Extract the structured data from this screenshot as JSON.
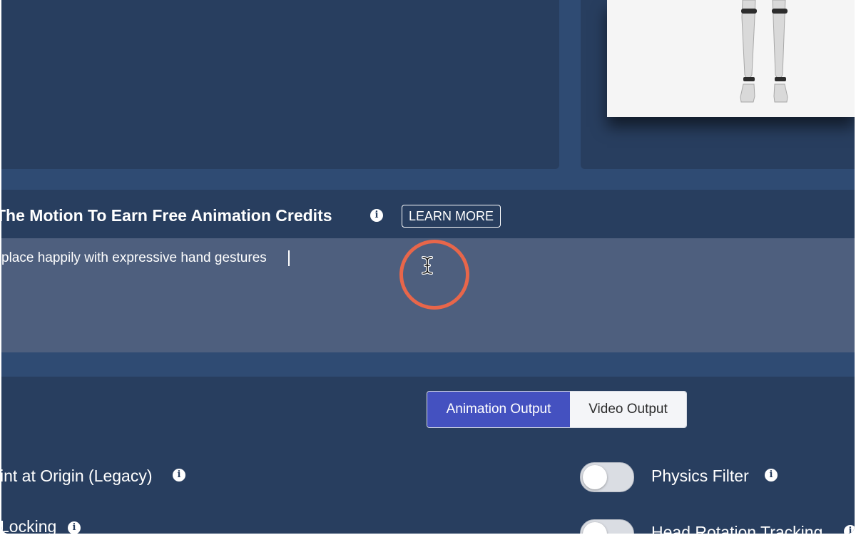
{
  "prompt_section": {
    "title": "The Motion To Earn Free Animation Credits",
    "info_glyph": "i",
    "learn_more_label": "LEARN MORE",
    "prompt_text": "place happily with expressive hand gestures"
  },
  "output_tabs": {
    "active": "Animation Output",
    "items": [
      {
        "label": "Animation Output"
      },
      {
        "label": "Video Output"
      }
    ]
  },
  "settings": {
    "left": [
      {
        "label": "int at Origin (Legacy)"
      },
      {
        "label": "Locking"
      }
    ],
    "right": [
      {
        "label": "Physics Filter",
        "enabled": false
      },
      {
        "label": "Head Rotation Tracking",
        "enabled": false
      }
    ]
  },
  "colors": {
    "background": "#2f4b73",
    "panel": "#283e5f",
    "prompt_area": "#4e5f7e",
    "accent": "#4451c0",
    "click_indicator": "#e8664a"
  },
  "icons": [
    "info-icon",
    "text-cursor-icon"
  ]
}
